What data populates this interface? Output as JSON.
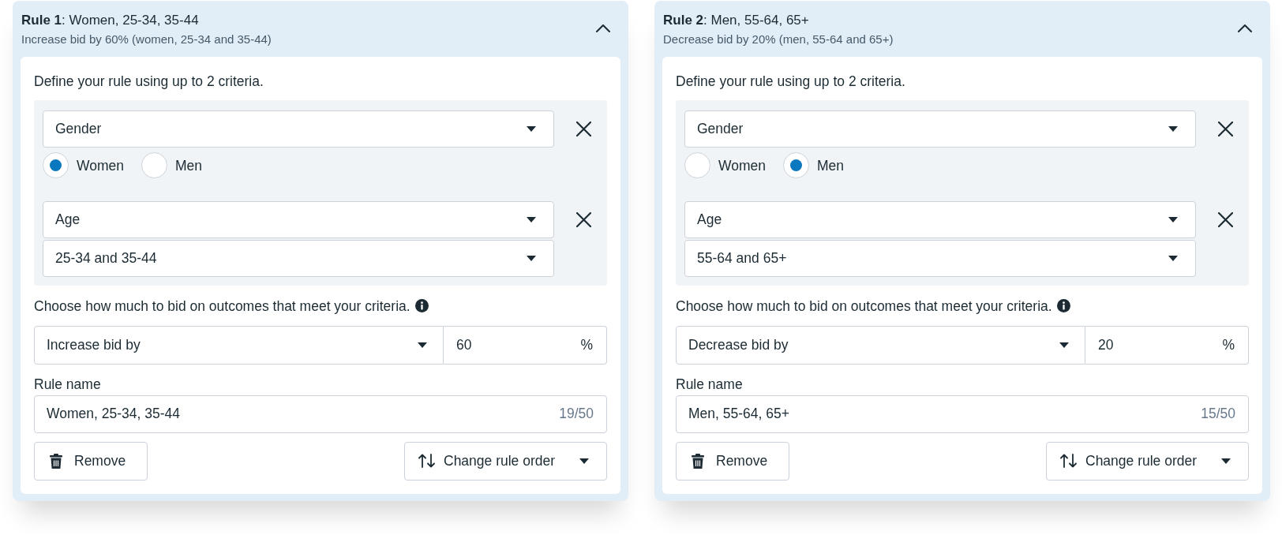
{
  "rules": [
    {
      "title": "**Rule 1**: Women, 25-34, 35-44",
      "summary": "Increase bid by 60% (women, 25-34 and 35-44)",
      "expanded": true,
      "instruction": "Define your rule using up to 2 criteria.",
      "criteria": [
        {
          "kind": "radio",
          "field": "Gender",
          "options": [
            {
              "label": "Women",
              "selected": true
            },
            {
              "label": "Men",
              "selected": false
            }
          ]
        },
        {
          "kind": "dropdown",
          "field": "Age",
          "value": "25-34 and 35-44"
        }
      ],
      "bid_prompt": "Choose how much to bid on outcomes that meet your criteria.",
      "bid_action": "Increase bid by",
      "bid_value": "60",
      "bid_unit": "%",
      "name_label": "Rule name",
      "name_value": "Women, 25-34, 35-44",
      "name_count": "19/50",
      "remove_label": "Remove",
      "order_label": "Change rule order"
    },
    {
      "title": "**Rule 2**: Men, 55-64, 65+",
      "summary": "Decrease bid by 20% (men, 55-64 and 65+)",
      "expanded": true,
      "instruction": "Define your rule using up to 2 criteria.",
      "criteria": [
        {
          "kind": "radio",
          "field": "Gender",
          "options": [
            {
              "label": "Women",
              "selected": false
            },
            {
              "label": "Men",
              "selected": true
            }
          ]
        },
        {
          "kind": "dropdown",
          "field": "Age",
          "value": "55-64 and 65+"
        }
      ],
      "bid_prompt": "Choose how much to bid on outcomes that meet your criteria.",
      "bid_action": "Decrease bid by",
      "bid_value": "20",
      "bid_unit": "%",
      "name_label": "Rule name",
      "name_value": "Men, 55-64, 65+",
      "name_count": "15/50",
      "remove_label": "Remove",
      "order_label": "Change rule order"
    }
  ]
}
